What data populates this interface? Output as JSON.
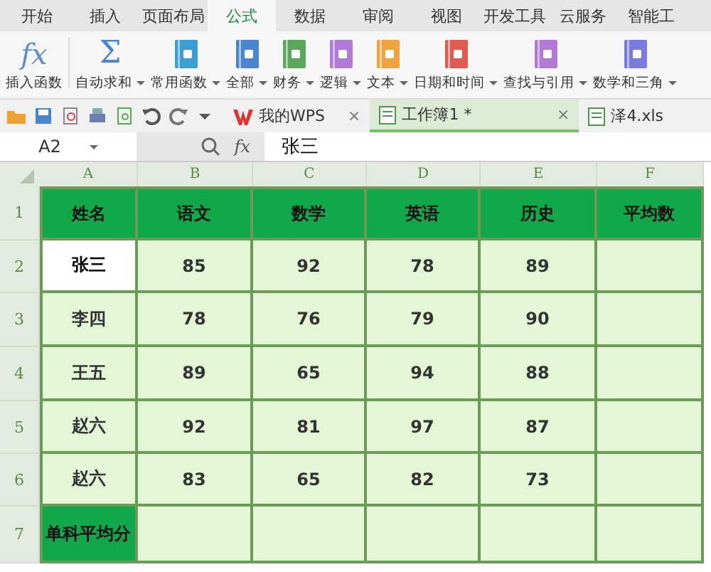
{
  "menu_tabs": [
    {
      "label": "开始",
      "selected": false
    },
    {
      "label": "插入",
      "selected": false
    },
    {
      "label": "页面布局",
      "selected": false
    },
    {
      "label": "公式",
      "selected": true
    },
    {
      "label": "数据",
      "selected": false
    },
    {
      "label": "审阅",
      "selected": false
    },
    {
      "label": "视图",
      "selected": false
    },
    {
      "label": "开发工具",
      "selected": false
    },
    {
      "label": "云服务",
      "selected": false
    },
    {
      "label": "智能工",
      "selected": false
    }
  ],
  "toolbar": [
    {
      "kind": "glyph",
      "glyph": "fx",
      "label": "插入函数",
      "dropdown": false
    },
    {
      "kind": "glyph",
      "glyph": "Σ",
      "label": "自动求和",
      "dropdown": true
    },
    {
      "kind": "book",
      "color": "#3b9fd6",
      "label": "常用函数",
      "dropdown": true
    },
    {
      "kind": "book",
      "color": "#4a86d0",
      "label": "全部",
      "dropdown": true
    },
    {
      "kind": "book",
      "color": "#5aa85a",
      "label": "财务",
      "dropdown": true
    },
    {
      "kind": "book",
      "color": "#b27ad6",
      "label": "逻辑",
      "dropdown": true
    },
    {
      "kind": "book",
      "color": "#f0a23c",
      "label": "文本",
      "dropdown": true
    },
    {
      "kind": "book",
      "color": "#e05a50",
      "label": "日期和时间",
      "dropdown": true
    },
    {
      "kind": "book",
      "color": "#b27ad6",
      "label": "查找与引用",
      "dropdown": true
    },
    {
      "kind": "book",
      "color": "#7a7ae0",
      "label": "数学和三角",
      "dropdown": true
    }
  ],
  "doc_tabs": [
    {
      "kind": "wps",
      "label": "我的WPS",
      "selected": false,
      "close": "×"
    },
    {
      "kind": "sheet",
      "label": "工作簿1 *",
      "selected": true,
      "close": "×"
    },
    {
      "kind": "sheet",
      "label": "泽4.xls",
      "selected": false
    }
  ],
  "formula_bar": {
    "cell_ref": "A2",
    "fx": "fx",
    "value": "张三"
  },
  "sheet": {
    "columns": [
      "A",
      "B",
      "C",
      "D",
      "E",
      "F"
    ],
    "rows": [
      {
        "number": "1",
        "kind": "header",
        "cells": [
          {
            "text": "姓名",
            "selected": false
          },
          {
            "text": "语文",
            "selected": false
          },
          {
            "text": "数学",
            "selected": false
          },
          {
            "text": "英语",
            "selected": false
          },
          {
            "text": "历史",
            "selected": false
          },
          {
            "text": "平均数",
            "selected": false
          }
        ]
      },
      {
        "number": "2",
        "kind": "data",
        "cells": [
          {
            "text": "张三",
            "selected": true
          },
          {
            "text": "85",
            "selected": false
          },
          {
            "text": "92",
            "selected": false
          },
          {
            "text": "78",
            "selected": false
          },
          {
            "text": "89",
            "selected": false
          },
          {
            "selected": false
          }
        ]
      },
      {
        "number": "3",
        "kind": "data",
        "cells": [
          {
            "text": "李四",
            "selected": false
          },
          {
            "text": "78",
            "selected": false
          },
          {
            "text": "76",
            "selected": false
          },
          {
            "text": "79",
            "selected": false
          },
          {
            "text": "90",
            "selected": false
          },
          {
            "selected": false
          }
        ]
      },
      {
        "number": "4",
        "kind": "data",
        "cells": [
          {
            "text": "王五",
            "selected": false
          },
          {
            "text": "89",
            "selected": false
          },
          {
            "text": "65",
            "selected": false
          },
          {
            "text": "94",
            "selected": false
          },
          {
            "text": "88",
            "selected": false
          },
          {
            "selected": false
          }
        ]
      },
      {
        "number": "5",
        "kind": "data",
        "cells": [
          {
            "text": "赵六",
            "selected": false
          },
          {
            "text": "92",
            "selected": false
          },
          {
            "text": "81",
            "selected": false
          },
          {
            "text": "97",
            "selected": false
          },
          {
            "text": "87",
            "selected": false
          },
          {
            "selected": false
          }
        ]
      },
      {
        "number": "6",
        "kind": "data",
        "cells": [
          {
            "text": "赵六",
            "selected": false
          },
          {
            "text": "83",
            "selected": false
          },
          {
            "text": "65",
            "selected": false
          },
          {
            "text": "82",
            "selected": false
          },
          {
            "text": "73",
            "selected": false
          },
          {
            "selected": false
          }
        ]
      },
      {
        "number": "7",
        "kind": "summary",
        "cells": [
          {
            "text": "单科平均分",
            "selected": false
          },
          {
            "selected": false
          },
          {
            "selected": false
          },
          {
            "selected": false
          },
          {
            "selected": false
          },
          {
            "selected": false
          }
        ]
      }
    ]
  }
}
